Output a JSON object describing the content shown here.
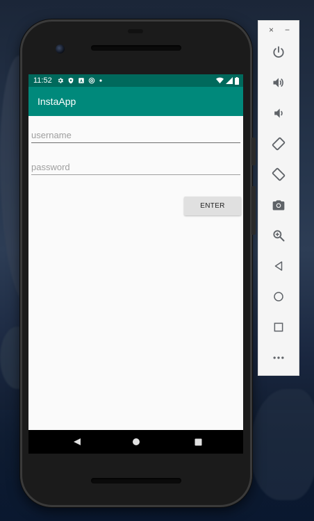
{
  "status_bar": {
    "time": "11:52",
    "icons_left": [
      "settings-icon",
      "shield-icon",
      "a-badge-icon",
      "at-icon",
      "dot-icon"
    ],
    "icons_right": [
      "wifi-icon",
      "signal-icon",
      "battery-icon"
    ]
  },
  "app_bar": {
    "title": "InstaApp"
  },
  "form": {
    "username_placeholder": "username",
    "username_value": "",
    "password_placeholder": "password",
    "password_value": "",
    "enter_label": "ENTER"
  },
  "nav_bar": {
    "buttons": [
      "back-icon",
      "home-icon",
      "recents-icon"
    ]
  },
  "emulator_toolbar": {
    "close_glyph": "×",
    "minimize_glyph": "−",
    "tools": [
      "power-icon",
      "volume-up-icon",
      "volume-down-icon",
      "rotate-left-icon",
      "rotate-right-icon",
      "camera-icon",
      "zoom-icon",
      "back-icon",
      "home-icon",
      "overview-icon",
      "more-icon"
    ]
  },
  "colors": {
    "status_bar": "#00695c",
    "app_bar": "#00897b",
    "content_bg": "#fafafa",
    "button_bg": "#e0e0e0",
    "toolbar_icon": "#5f6368"
  }
}
